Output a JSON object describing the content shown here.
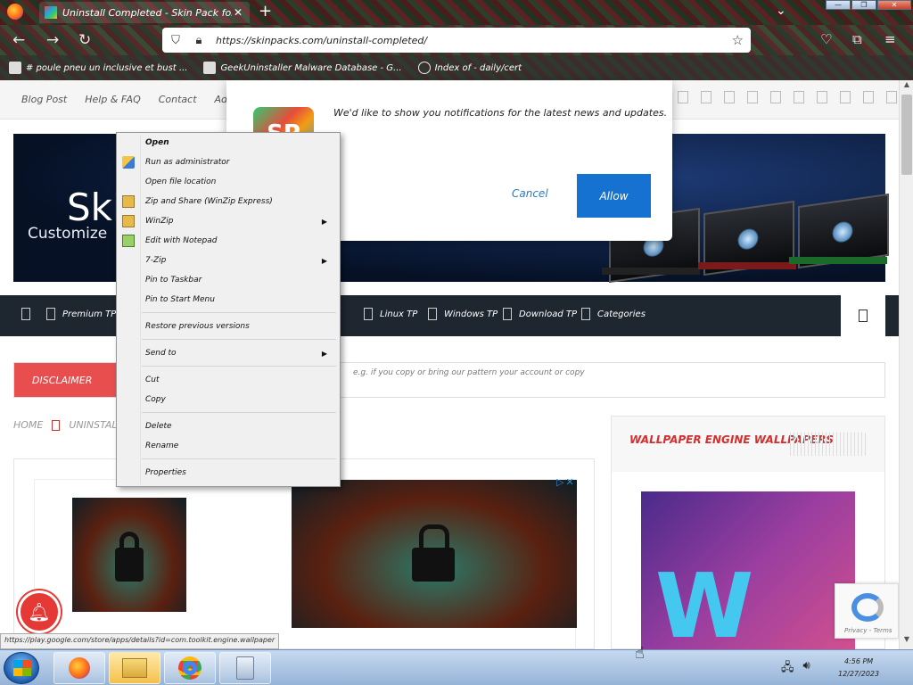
{
  "browser": {
    "tab_title": "Uninstall Completed - Skin Pack for Windows ...",
    "url": "https://skinpacks.com/uninstall-completed/",
    "bookmarks": [
      "# poule pneu un inclusive et bust ...",
      "GeekUninstaller Malware Database - G...",
      "Index of - daily/cert"
    ]
  },
  "site": {
    "topnav": [
      "Blog Post",
      "Help & FAQ",
      "Contact",
      "Advertise"
    ],
    "banner_title": "Skin",
    "banner_sub": "Customize",
    "categories": [
      "Premium TP",
      "Linux TP",
      "Windows TP",
      "Download TP",
      "Categories"
    ],
    "notice_badge": "DISCLAIMER",
    "notice_text": "e.g. if you copy or bring our pattern your account or copy",
    "breadcrumb_home": "HOME",
    "breadcrumb_current": "UNINSTALL",
    "sidebar_title": "WALLPAPER ENGINE WALLPAPERS",
    "status_url": "https://play.google.com/store/apps/details?id=com.toolkit.engine.wallpaper",
    "recaptcha_text": "Privacy - Terms"
  },
  "dialog": {
    "message": "We'd like to show you notifications for the latest news and updates.",
    "logo_text": "SP",
    "cancel_label": "Cancel",
    "allow_label": "Allow"
  },
  "context_menu": {
    "items": [
      {
        "label": "Open"
      },
      {
        "label": "Run as administrator"
      },
      {
        "label": "Open file location"
      },
      {
        "label": "Zip and Share (WinZip Express)"
      },
      {
        "label": "WinZip"
      },
      {
        "label": "Edit with Notepad"
      },
      {
        "label": "7-Zip"
      },
      {
        "label": "Pin to Taskbar"
      },
      {
        "label": "Pin to Start Menu"
      },
      {
        "label": "Restore previous versions"
      },
      {
        "label": "Send to"
      },
      {
        "label": "Cut"
      },
      {
        "label": "Copy"
      },
      {
        "label": "Delete"
      },
      {
        "label": "Rename"
      },
      {
        "label": "Properties"
      }
    ]
  },
  "taskbar": {
    "clock_time": "4:56 PM",
    "clock_date": "12/27/2023"
  },
  "colors": {
    "accent": "#1672d0",
    "alert": "#e84e4e",
    "taskbar": "#95b4d8"
  }
}
